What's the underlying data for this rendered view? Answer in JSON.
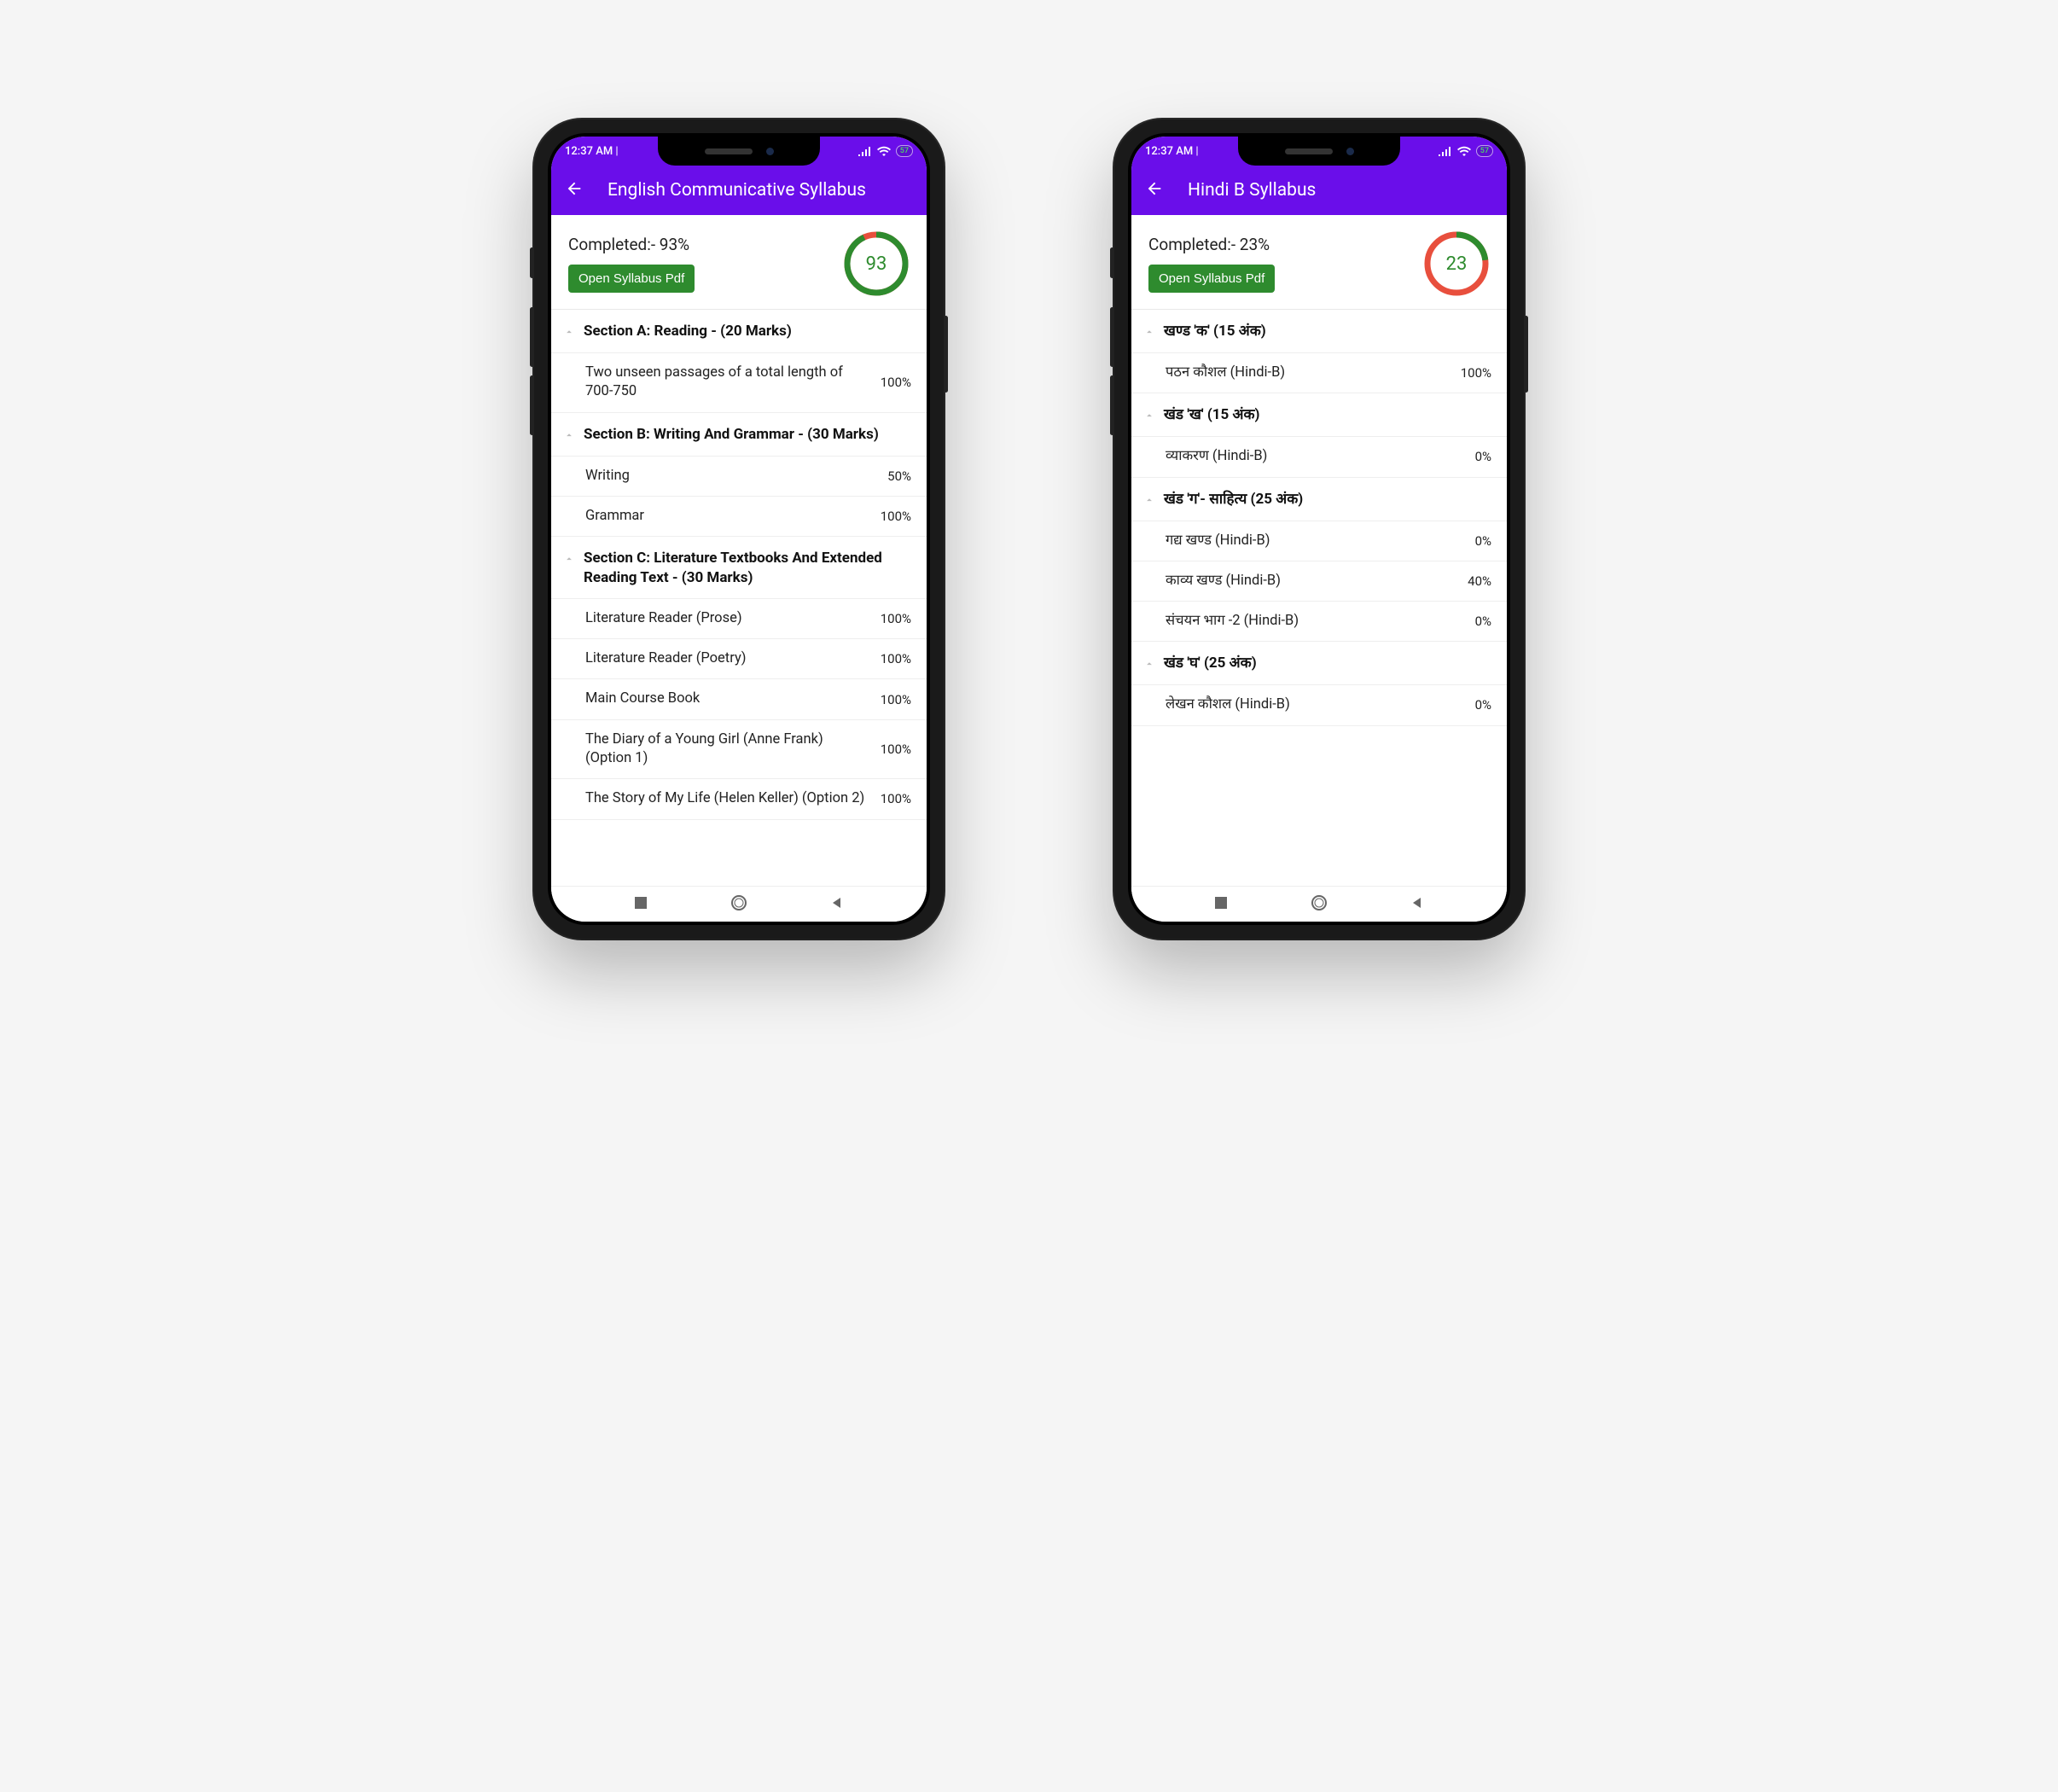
{
  "phones": [
    {
      "status_time": "12:37 AM | ‎",
      "battery": "57",
      "app_title": "English Communicative Syllabus",
      "completed_label": "Completed:- 93%",
      "pdf_btn": "Open Syllabus Pdf",
      "progress_pct": 93,
      "progress_text": "93",
      "sections": [
        {
          "title": "Section A: Reading - (20 Marks)",
          "topics": [
            {
              "name": "Two unseen passages of a total length of 700-750",
              "pct": "100%"
            }
          ]
        },
        {
          "title": "Section B: Writing And Grammar - (30 Marks)",
          "topics": [
            {
              "name": "Writing",
              "pct": "50%"
            },
            {
              "name": "Grammar",
              "pct": "100%"
            }
          ]
        },
        {
          "title": "Section C: Literature Textbooks And Extended Reading Text - (30 Marks)",
          "topics": [
            {
              "name": "Literature Reader (Prose)",
              "pct": "100%"
            },
            {
              "name": "Literature Reader (Poetry)",
              "pct": "100%"
            },
            {
              "name": "Main Course Book",
              "pct": "100%"
            },
            {
              "name": "The Diary of a Young Girl (Anne Frank) (Option 1)",
              "pct": "100%"
            },
            {
              "name": "The Story of My Life (Helen Keller) (Option 2)",
              "pct": "100%"
            }
          ]
        }
      ]
    },
    {
      "status_time": "12:37 AM | ‎",
      "battery": "57",
      "app_title": "Hindi B Syllabus",
      "completed_label": "Completed:- 23%",
      "pdf_btn": "Open Syllabus Pdf",
      "progress_pct": 23,
      "progress_text": "23",
      "sections": [
        {
          "title": "खण्ड 'क' (15 अंक)",
          "topics": [
            {
              "name": "पठन कौशल (Hindi-B)",
              "pct": "100%"
            }
          ]
        },
        {
          "title": "खंड 'ख' (15 अंक)",
          "topics": [
            {
              "name": "व्याकरण (Hindi-B)",
              "pct": "0%"
            }
          ]
        },
        {
          "title": "खंड 'ग'- साहित्य (25 अंक)",
          "topics": [
            {
              "name": "गद्य खण्ड (Hindi-B)",
              "pct": "0%"
            },
            {
              "name": "काव्य खण्ड (Hindi-B)",
              "pct": "40%"
            },
            {
              "name": "संचयन भाग -2 (Hindi-B)",
              "pct": "0%"
            }
          ]
        },
        {
          "title": "खंड 'घ' (25 अंक)",
          "topics": [
            {
              "name": "लेखन कौशल (Hindi-B)",
              "pct": "0%"
            }
          ]
        }
      ]
    }
  ],
  "colors": {
    "accent": "#6a0eea",
    "green": "#2e8b2e",
    "red": "#e84f3d"
  }
}
